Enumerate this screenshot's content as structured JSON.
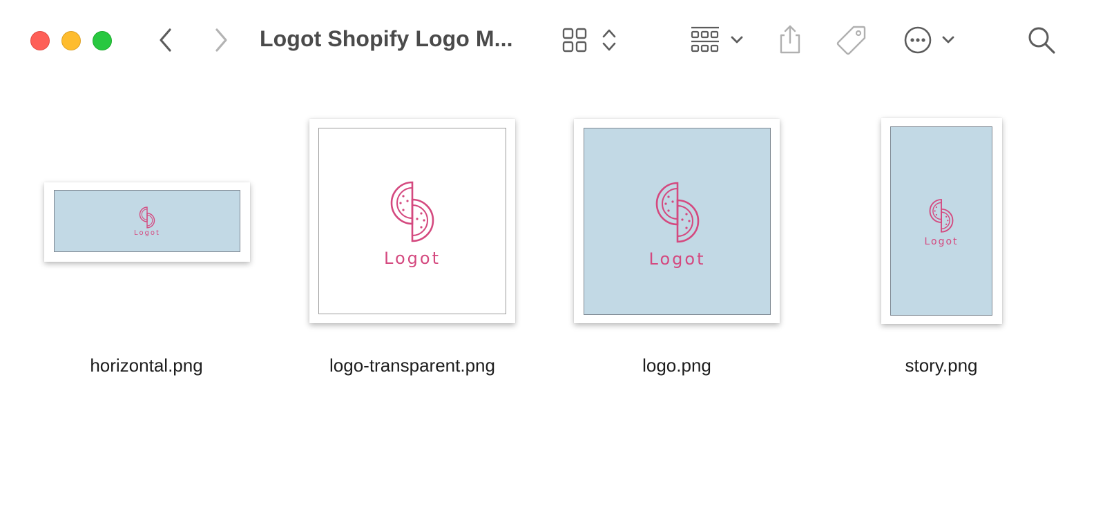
{
  "window": {
    "title": "Logot Shopify Logo M..."
  },
  "toolbar": {
    "icons": [
      "chevron-left-icon",
      "chevron-right-icon",
      "grid-view-icon",
      "sort-arrows-icon",
      "group-view-icon",
      "chevron-down-icon",
      "share-icon",
      "tag-icon",
      "more-options-icon",
      "search-icon"
    ]
  },
  "colors": {
    "close": "#fe5f57",
    "minimize": "#febc2e",
    "maximize": "#28c840",
    "thumb_blue": "#c2d9e5",
    "logo_pink": "#d4497f"
  },
  "files": [
    {
      "name": "horizontal.png",
      "logo_text": "Logot"
    },
    {
      "name": "logo-transparent.png",
      "logo_text": "Logot"
    },
    {
      "name": "logo.png",
      "logo_text": "Logot"
    },
    {
      "name": "story.png",
      "logo_text": "Logot"
    }
  ]
}
